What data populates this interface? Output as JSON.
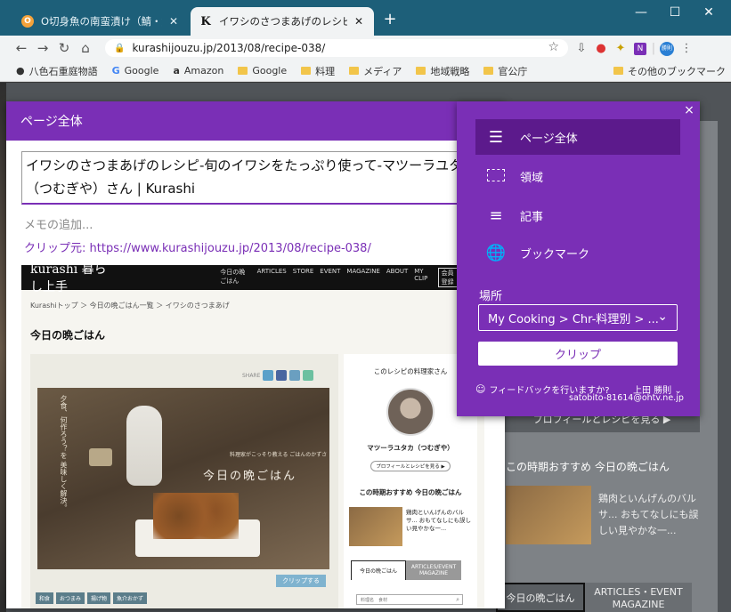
{
  "browser": {
    "tabs": [
      {
        "title": "O切身魚の南蛮漬け（鯖・鮭・かじき",
        "favicon": "O"
      },
      {
        "title": "イワシのさつまあげのレシピ-旬のイワシ",
        "favicon": "K"
      }
    ],
    "new_tab": "+",
    "url": "kurashijouzu.jp/2013/08/recipe-038/",
    "bookmarks": [
      {
        "label": "八色石重庭物語",
        "icon": "●"
      },
      {
        "label": "Google",
        "icon": "G"
      },
      {
        "label": "Amazon",
        "icon": "a"
      },
      {
        "label": "Google",
        "icon": "folder"
      },
      {
        "label": "料理",
        "icon": "folder"
      },
      {
        "label": "メディア",
        "icon": "folder"
      },
      {
        "label": "地域戦略",
        "icon": "folder"
      },
      {
        "label": "官公庁",
        "icon": "folder"
      }
    ],
    "other_bookmarks": "その他のブックマーク",
    "profile_label": "勝則",
    "onenote_label": "N"
  },
  "clipper": {
    "header": "ページ全体",
    "page_title": "イワシのさつまあげのレシピ-旬のイワシをたっぷり使って-マツーラユタカ（つむぎや）さん | Kurashi",
    "note_placeholder": "メモの追加...",
    "source": "クリップ元: https://www.kurashijouzu.jp/2013/08/recipe-038/"
  },
  "preview": {
    "logo": "kurashi 暮らし上手",
    "nav": [
      "今日の晩ごはん",
      "ARTICLES",
      "STORE",
      "EVENT",
      "MAGAZINE",
      "ABOUT",
      "MY CLIP",
      "会員登録",
      "ログ"
    ],
    "breadcrumb": "Kurashiトップ ＞ 今日の晩ごはん一覧 ＞ イワシのさつまあげ",
    "section": "今日の晩ごはん",
    "share": "SHARE",
    "photo_title": "今日の晩ごはん",
    "photo_sub": "料理家がこっそり教える ごはんのかずさ",
    "photo_vert": "夕食、何作ろう？を 美味しく解決。",
    "clip_button": "クリップする",
    "tags": [
      "和食",
      "おつまみ",
      "揚げ物",
      "魚介おかず"
    ],
    "sidebar_heading": "このレシピの料理家さん",
    "chef_name": "マツーラユタカ（つむぎや）",
    "profile_button": "プロフィールとレシピを見る ▶",
    "season_heading": "この時期おすすめ 今日の晩ごはん",
    "season_item": "鶏肉といんげんのバルサ... おもてなしにも誤しい見やかな一...",
    "tab_a": "今日の晩ごはん",
    "tab_b": "ARTICLES/EVENT MAGAZINE",
    "search_placeholder": "料理名　食材"
  },
  "panel": {
    "close": "×",
    "options": [
      {
        "label": "ページ全体",
        "icon": "full-page-icon",
        "selected": true
      },
      {
        "label": "領域",
        "icon": "region-icon",
        "selected": false
      },
      {
        "label": "記事",
        "icon": "article-icon",
        "selected": false
      },
      {
        "label": "ブックマーク",
        "icon": "bookmark-globe-icon",
        "selected": false
      }
    ],
    "location_label": "場所",
    "location_value": "My Cooking > Chr-料理別 > ...",
    "clip_button": "クリップ",
    "feedback": "フィードバックを行いますか?",
    "user_name": "上田 勝則",
    "user_email": "satobito-81614@ohtv.ne.jp"
  },
  "background_page": {
    "profile_button": "プロフィールとレシピを見る ▶",
    "season_heading": "この時期おすすめ 今日の晩ごはん",
    "season_item": "鶏肉といんげんのバルサ... おもてなしにも誤しい見やかな一...",
    "tab_a": "今日の晩ごはん",
    "tab_b": "ARTICLES・EVENT MAGAZINE"
  }
}
